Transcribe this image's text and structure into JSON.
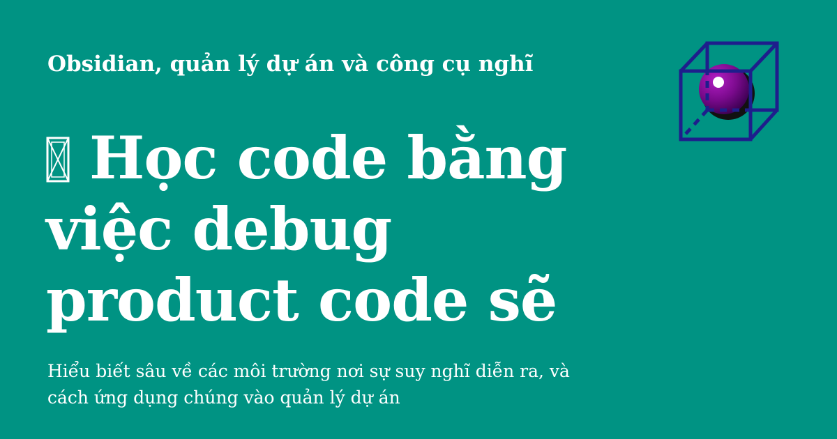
{
  "kicker": "Obsidian, quản lý dự án và công cụ nghĩ",
  "title": {
    "lines": [
      "Học code bằng",
      "việc debug",
      "product code sẽ"
    ]
  },
  "subtitle": {
    "lines": [
      "Hiểu biết sâu về các môi trường nơi sự suy nghĩ diễn ra, và",
      "cách ứng dụng chúng vào quản lý dự án"
    ]
  },
  "colors": {
    "background": "#009383",
    "text": "#ffffff",
    "cube": "#1e1e8c",
    "sphere": "#7a0a8c"
  },
  "icons": {
    "title_prefix": "missing-glyph-icon",
    "logo": "cube-sphere-logo-icon"
  }
}
